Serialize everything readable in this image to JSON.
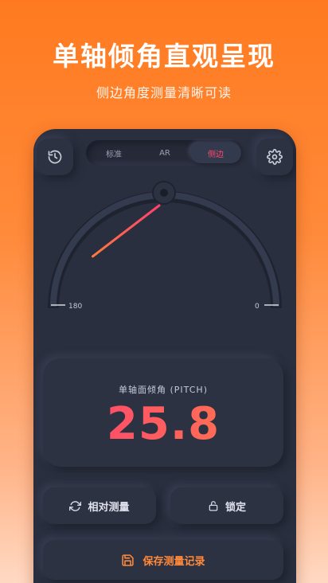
{
  "promo": {
    "headline": "单轴倾角直观呈现",
    "subline": "侧边角度测量清晰可读"
  },
  "toolbar": {
    "history_icon": "history-icon",
    "settings_icon": "gear-icon",
    "modes": [
      {
        "label": "标准",
        "active": false
      },
      {
        "label": "AR",
        "active": false
      },
      {
        "label": "侧边",
        "active": true
      }
    ]
  },
  "gauge": {
    "left_label": "180",
    "right_label": "0",
    "pointer_angle_deg": 25.8,
    "pointer_color_start": "#ff7a3d",
    "pointer_color_end": "#ff3f6e"
  },
  "reading": {
    "label": "单轴面倾角 (PITCH)",
    "value": "25.8"
  },
  "actions": {
    "relative_label": "相对测量",
    "lock_label": "锁定",
    "save_label": "保存测量记录"
  },
  "colors": {
    "background_top": "#ff7a1f",
    "panel": "#2a2f3f",
    "accent_pink": "#ff4a6e",
    "accent_orange": "#ff8a3c"
  }
}
